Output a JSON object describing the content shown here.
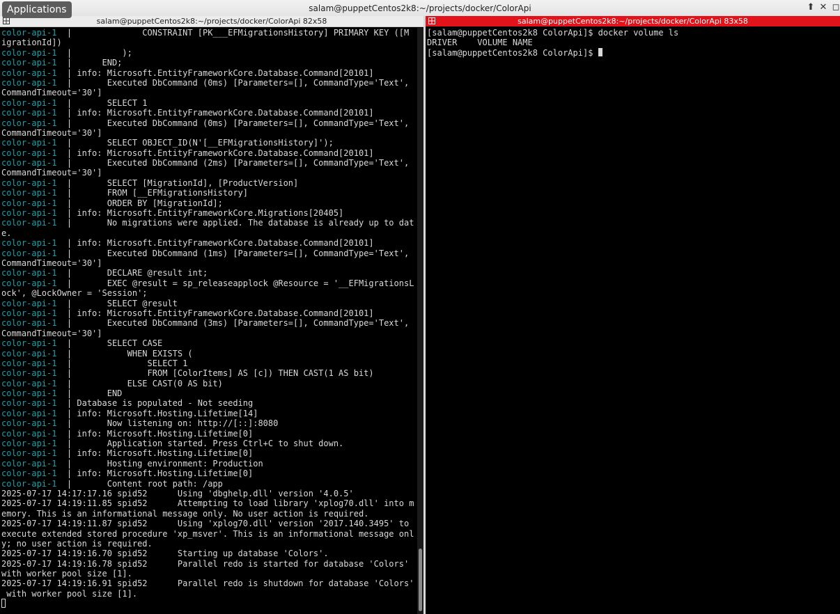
{
  "window": {
    "title": "salam@puppetCentos2k8:~/projects/docker/ColorApi"
  },
  "apps_menu": {
    "label": "Applications"
  },
  "left_pane": {
    "title": "salam@puppetCentos2k8:~/projects/docker/ColorApi 82x58",
    "lines": [
      {
        "p": "color-api-1  ",
        "t": "|              CONSTRAINT [PK___EFMigrationsHistory] PRIMARY KEY ([M"
      },
      {
        "p": "",
        "t": "igrationId])"
      },
      {
        "p": "color-api-1  ",
        "t": "|          );"
      },
      {
        "p": "color-api-1  ",
        "t": "|      END;"
      },
      {
        "p": "color-api-1  ",
        "t": "| info: Microsoft.EntityFrameworkCore.Database.Command[20101]"
      },
      {
        "p": "color-api-1  ",
        "t": "|       Executed DbCommand (0ms) [Parameters=[], CommandType='Text',"
      },
      {
        "p": "",
        "t": "CommandTimeout='30']"
      },
      {
        "p": "color-api-1  ",
        "t": "|       SELECT 1"
      },
      {
        "p": "color-api-1  ",
        "t": "| info: Microsoft.EntityFrameworkCore.Database.Command[20101]"
      },
      {
        "p": "color-api-1  ",
        "t": "|       Executed DbCommand (0ms) [Parameters=[], CommandType='Text',"
      },
      {
        "p": "",
        "t": "CommandTimeout='30']"
      },
      {
        "p": "color-api-1  ",
        "t": "|       SELECT OBJECT_ID(N'[__EFMigrationsHistory]');"
      },
      {
        "p": "color-api-1  ",
        "t": "| info: Microsoft.EntityFrameworkCore.Database.Command[20101]"
      },
      {
        "p": "color-api-1  ",
        "t": "|       Executed DbCommand (2ms) [Parameters=[], CommandType='Text',"
      },
      {
        "p": "",
        "t": "CommandTimeout='30']"
      },
      {
        "p": "color-api-1  ",
        "t": "|       SELECT [MigrationId], [ProductVersion]"
      },
      {
        "p": "color-api-1  ",
        "t": "|       FROM [__EFMigrationsHistory]"
      },
      {
        "p": "color-api-1  ",
        "t": "|       ORDER BY [MigrationId];"
      },
      {
        "p": "color-api-1  ",
        "t": "| info: Microsoft.EntityFrameworkCore.Migrations[20405]"
      },
      {
        "p": "color-api-1  ",
        "t": "|       No migrations were applied. The database is already up to dat"
      },
      {
        "p": "",
        "t": "e."
      },
      {
        "p": "color-api-1  ",
        "t": "| info: Microsoft.EntityFrameworkCore.Database.Command[20101]"
      },
      {
        "p": "color-api-1  ",
        "t": "|       Executed DbCommand (1ms) [Parameters=[], CommandType='Text',"
      },
      {
        "p": "",
        "t": "CommandTimeout='30']"
      },
      {
        "p": "color-api-1  ",
        "t": "|       DECLARE @result int;"
      },
      {
        "p": "color-api-1  ",
        "t": "|       EXEC @result = sp_releaseapplock @Resource = '__EFMigrationsL"
      },
      {
        "p": "",
        "t": "ock', @LockOwner = 'Session';"
      },
      {
        "p": "color-api-1  ",
        "t": "|       SELECT @result"
      },
      {
        "p": "color-api-1  ",
        "t": "| info: Microsoft.EntityFrameworkCore.Database.Command[20101]"
      },
      {
        "p": "color-api-1  ",
        "t": "|       Executed DbCommand (3ms) [Parameters=[], CommandType='Text',"
      },
      {
        "p": "",
        "t": "CommandTimeout='30']"
      },
      {
        "p": "color-api-1  ",
        "t": "|       SELECT CASE"
      },
      {
        "p": "color-api-1  ",
        "t": "|           WHEN EXISTS ("
      },
      {
        "p": "color-api-1  ",
        "t": "|               SELECT 1"
      },
      {
        "p": "color-api-1  ",
        "t": "|               FROM [ColorItems] AS [c]) THEN CAST(1 AS bit)"
      },
      {
        "p": "color-api-1  ",
        "t": "|           ELSE CAST(0 AS bit)"
      },
      {
        "p": "color-api-1  ",
        "t": "|       END"
      },
      {
        "p": "color-api-1  ",
        "t": "| Database is populated - Not seeding"
      },
      {
        "p": "color-api-1  ",
        "t": "| info: Microsoft.Hosting.Lifetime[14]"
      },
      {
        "p": "color-api-1  ",
        "t": "|       Now listening on: http://[::]:8080"
      },
      {
        "p": "color-api-1  ",
        "t": "| info: Microsoft.Hosting.Lifetime[0]"
      },
      {
        "p": "color-api-1  ",
        "t": "|       Application started. Press Ctrl+C to shut down."
      },
      {
        "p": "color-api-1  ",
        "t": "| info: Microsoft.Hosting.Lifetime[0]"
      },
      {
        "p": "color-api-1  ",
        "t": "|       Hosting environment: Production"
      },
      {
        "p": "color-api-1  ",
        "t": "| info: Microsoft.Hosting.Lifetime[0]"
      },
      {
        "p": "color-api-1  ",
        "t": "|       Content root path: /app"
      },
      {
        "p": "",
        "t": "2025-07-17 14:17:17.16 spid52      Using 'dbghelp.dll' version '4.0.5'"
      },
      {
        "p": "",
        "t": "2025-07-17 14:19:11.85 spid52      Attempting to load library 'xplog70.dll' into m"
      },
      {
        "p": "",
        "t": "emory. This is an informational message only. No user action is required."
      },
      {
        "p": "",
        "t": "2025-07-17 14:19:11.87 spid52      Using 'xplog70.dll' version '2017.140.3495' to"
      },
      {
        "p": "",
        "t": "execute extended stored procedure 'xp_msver'. This is an informational message onl"
      },
      {
        "p": "",
        "t": "y; no user action is required."
      },
      {
        "p": "",
        "t": "2025-07-17 14:19:16.70 spid52      Starting up database 'Colors'."
      },
      {
        "p": "",
        "t": "2025-07-17 14:19:16.78 spid52      Parallel redo is started for database 'Colors'"
      },
      {
        "p": "",
        "t": "with worker pool size [1]."
      },
      {
        "p": "",
        "t": "2025-07-17 14:19:16.91 spid52      Parallel redo is shutdown for database 'Colors'"
      },
      {
        "p": "",
        "t": " with worker pool size [1]."
      }
    ]
  },
  "right_pane": {
    "title": "salam@puppetCentos2k8:~/projects/docker/ColorApi 83x58",
    "lines": [
      "[salam@puppetCentos2k8 ColorApi]$ docker volume ls",
      "DRIVER    VOLUME NAME"
    ],
    "prompt": "[salam@puppetCentos2k8 ColorApi]$ "
  },
  "colors": {
    "prefix": "#18a2a8",
    "active_title_bg": "#e3131b",
    "terminal_bg": "#000000",
    "terminal_fg": "#d9d9d9"
  },
  "icons": [
    "minimize-icon",
    "maximize-icon",
    "close-icon",
    "terminal-icon"
  ]
}
